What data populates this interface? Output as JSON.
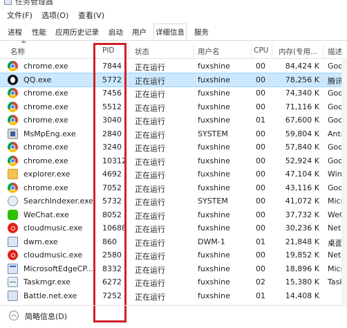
{
  "window": {
    "title": "任务管理器"
  },
  "menu": [
    "文件(F)",
    "选项(O)",
    "查看(V)"
  ],
  "tabs": [
    "进程",
    "性能",
    "应用历史记录",
    "启动",
    "用户",
    "详细信息",
    "服务"
  ],
  "active_tab": "详细信息",
  "columns": {
    "name": "名称",
    "pid": "PID",
    "status": "状态",
    "user": "用户名",
    "cpu": "CPU",
    "memory": "内存(专用...",
    "desc": "描述"
  },
  "rows": [
    {
      "name": "chrome.exe",
      "icon": "chrome-icon",
      "pid": "7844",
      "status": "正在运行",
      "user": "fuxshine",
      "cpu": "00",
      "memory": "84,424 K",
      "desc": "Goog"
    },
    {
      "name": "QQ.exe",
      "icon": "qq-icon",
      "pid": "5772",
      "status": "正在运行",
      "user": "fuxshine",
      "cpu": "00",
      "memory": "78,256 K",
      "desc": "腾讯C"
    },
    {
      "name": "chrome.exe",
      "icon": "chrome-icon",
      "pid": "7456",
      "status": "正在运行",
      "user": "fuxshine",
      "cpu": "00",
      "memory": "74,340 K",
      "desc": "Goog"
    },
    {
      "name": "chrome.exe",
      "icon": "chrome-icon",
      "pid": "5512",
      "status": "正在运行",
      "user": "fuxshine",
      "cpu": "00",
      "memory": "71,116 K",
      "desc": "Goog"
    },
    {
      "name": "chrome.exe",
      "icon": "chrome-icon",
      "pid": "3040",
      "status": "正在运行",
      "user": "fuxshine",
      "cpu": "01",
      "memory": "67,600 K",
      "desc": "Goog"
    },
    {
      "name": "MsMpEng.exe",
      "icon": "msmpeng-icon",
      "pid": "2840",
      "status": "正在运行",
      "user": "SYSTEM",
      "cpu": "00",
      "memory": "59,804 K",
      "desc": "Antim"
    },
    {
      "name": "chrome.exe",
      "icon": "chrome-icon",
      "pid": "3240",
      "status": "正在运行",
      "user": "fuxshine",
      "cpu": "00",
      "memory": "57,840 K",
      "desc": "Goog"
    },
    {
      "name": "chrome.exe",
      "icon": "chrome-icon",
      "pid": "10312",
      "status": "正在运行",
      "user": "fuxshine",
      "cpu": "00",
      "memory": "52,924 K",
      "desc": "Goog"
    },
    {
      "name": "explorer.exe",
      "icon": "explorer-icon",
      "pid": "4692",
      "status": "正在运行",
      "user": "fuxshine",
      "cpu": "00",
      "memory": "47,104 K",
      "desc": "Wind"
    },
    {
      "name": "chrome.exe",
      "icon": "chrome-icon",
      "pid": "7052",
      "status": "正在运行",
      "user": "fuxshine",
      "cpu": "00",
      "memory": "43,116 K",
      "desc": "Goog"
    },
    {
      "name": "SearchIndexer.exe",
      "icon": "search-indexer-icon",
      "pid": "5732",
      "status": "正在运行",
      "user": "SYSTEM",
      "cpu": "00",
      "memory": "41,072 K",
      "desc": "Micro"
    },
    {
      "name": "WeChat.exe",
      "icon": "wechat-icon",
      "pid": "8052",
      "status": "正在运行",
      "user": "fuxshine",
      "cpu": "00",
      "memory": "37,732 K",
      "desc": "WeCh"
    },
    {
      "name": "cloudmusic.exe",
      "icon": "cloudmusic-icon",
      "pid": "10688",
      "status": "正在运行",
      "user": "fuxshine",
      "cpu": "00",
      "memory": "30,236 K",
      "desc": "NetEa"
    },
    {
      "name": "dwm.exe",
      "icon": "dwm-icon",
      "pid": "860",
      "status": "正在运行",
      "user": "DWM-1",
      "cpu": "01",
      "memory": "21,848 K",
      "desc": "桌面窗"
    },
    {
      "name": "cloudmusic.exe",
      "icon": "cloudmusic-icon",
      "pid": "2580",
      "status": "正在运行",
      "user": "fuxshine",
      "cpu": "00",
      "memory": "19,852 K",
      "desc": "NetEa"
    },
    {
      "name": "MicrosoftEdgeCP....",
      "icon": "edge-icon",
      "pid": "8332",
      "status": "正在运行",
      "user": "fuxshine",
      "cpu": "00",
      "memory": "18,896 K",
      "desc": "Micro"
    },
    {
      "name": "Taskmgr.exe",
      "icon": "taskmgr-icon",
      "pid": "6272",
      "status": "正在运行",
      "user": "fuxshine",
      "cpu": "02",
      "memory": "15,380 K",
      "desc": "Task"
    },
    {
      "name": "Battle.net.exe",
      "icon": "app-icon",
      "pid": "7252",
      "status": "正在运行",
      "user": "fuxshine",
      "cpu": "01",
      "memory": "14,408 K",
      "desc": ""
    }
  ],
  "selected_row_index": 1,
  "footer": {
    "label": "简略信息(D)"
  },
  "colors": {
    "highlight_box": "#d01f26",
    "selected_row": "#cce8ff"
  }
}
